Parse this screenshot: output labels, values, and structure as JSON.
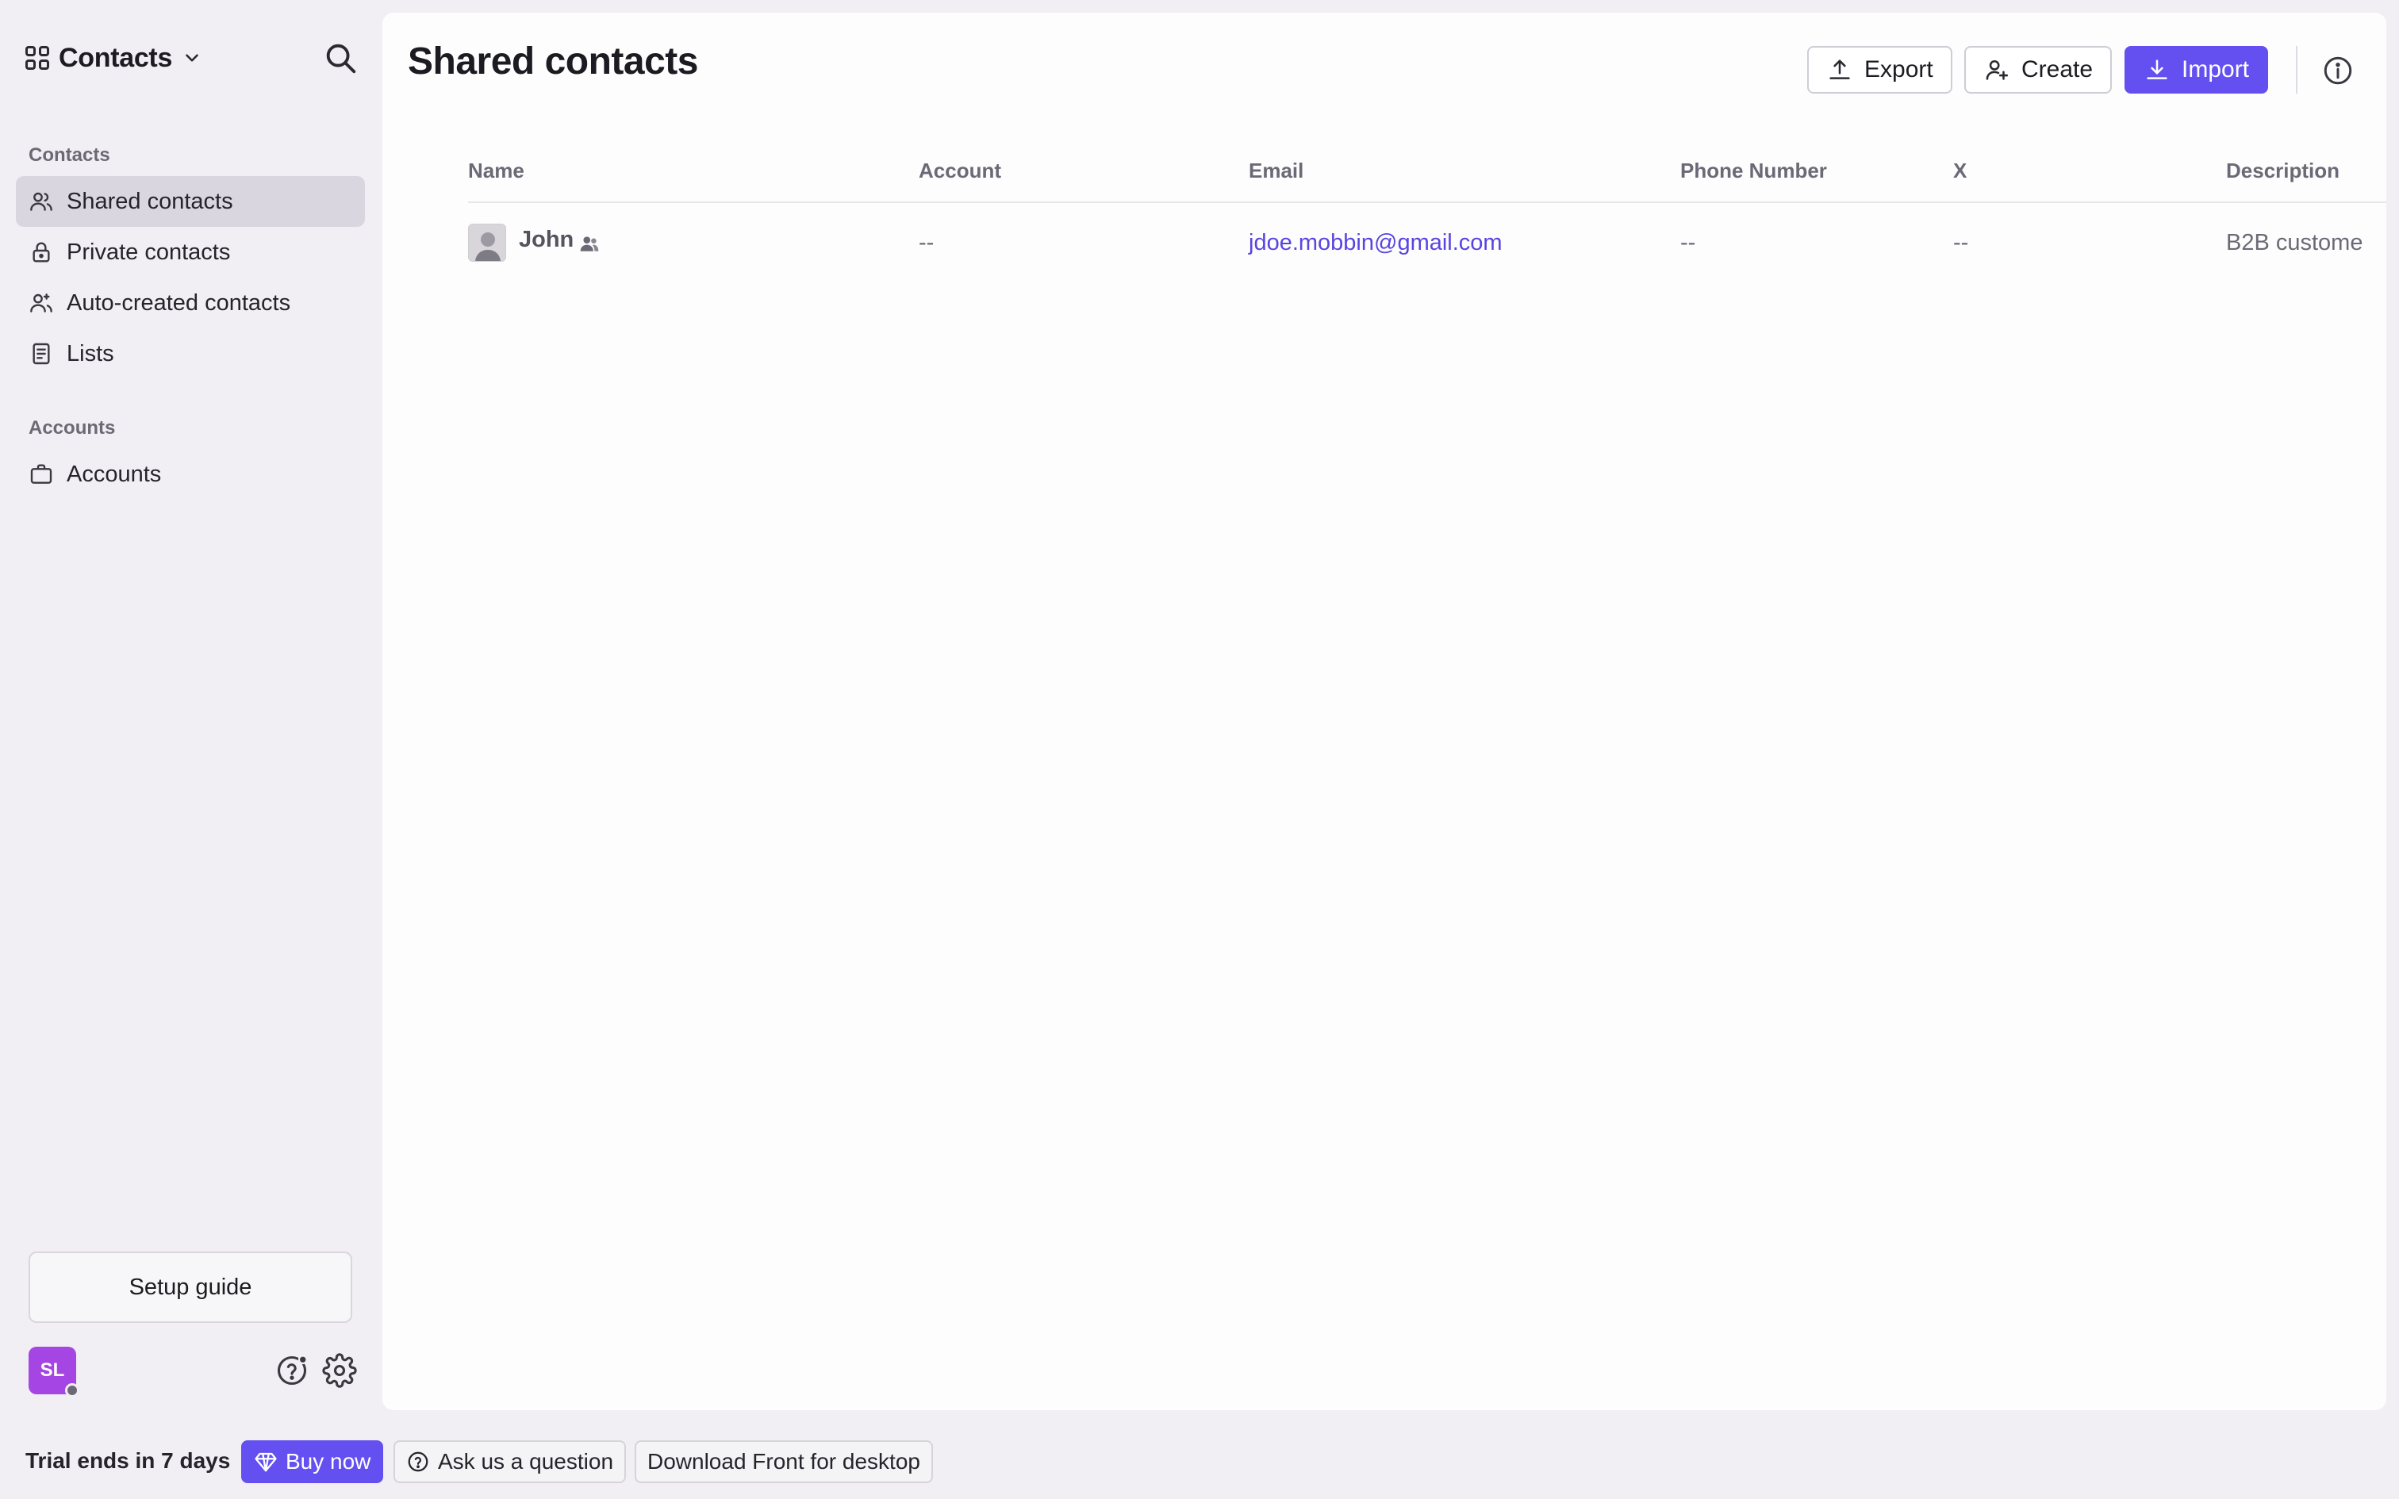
{
  "app": {
    "title": "Contacts"
  },
  "sidebar": {
    "sections": [
      {
        "label": "Contacts",
        "items": [
          {
            "label": "Shared contacts",
            "icon": "users-icon",
            "active": true
          },
          {
            "label": "Private contacts",
            "icon": "lock-icon",
            "active": false
          },
          {
            "label": "Auto-created contacts",
            "icon": "auto-users-icon",
            "active": false
          },
          {
            "label": "Lists",
            "icon": "list-doc-icon",
            "active": false
          }
        ]
      },
      {
        "label": "Accounts",
        "items": [
          {
            "label": "Accounts",
            "icon": "briefcase-icon",
            "active": false
          }
        ]
      }
    ],
    "setup_guide": "Setup guide",
    "avatar_initials": "SL"
  },
  "main": {
    "title": "Shared contacts",
    "actions": {
      "export": "Export",
      "create": "Create",
      "import": "Import"
    },
    "table": {
      "columns": [
        "Name",
        "Account",
        "Email",
        "Phone Number",
        "X",
        "Description"
      ],
      "rows": [
        {
          "name": "John",
          "account": "--",
          "email": "jdoe.mobbin@gmail.com",
          "phone": "--",
          "x": "--",
          "description": "B2B custome"
        }
      ]
    }
  },
  "bottom_bar": {
    "trial": "Trial ends in 7 days",
    "buy_now": "Buy now",
    "ask": "Ask us a question",
    "download": "Download Front for desktop"
  },
  "colors": {
    "accent": "#6450f0",
    "link": "#5845e0",
    "avatar": "#a445e4",
    "sidebar_bg": "#f1eff3",
    "active_item": "#dad6df"
  }
}
